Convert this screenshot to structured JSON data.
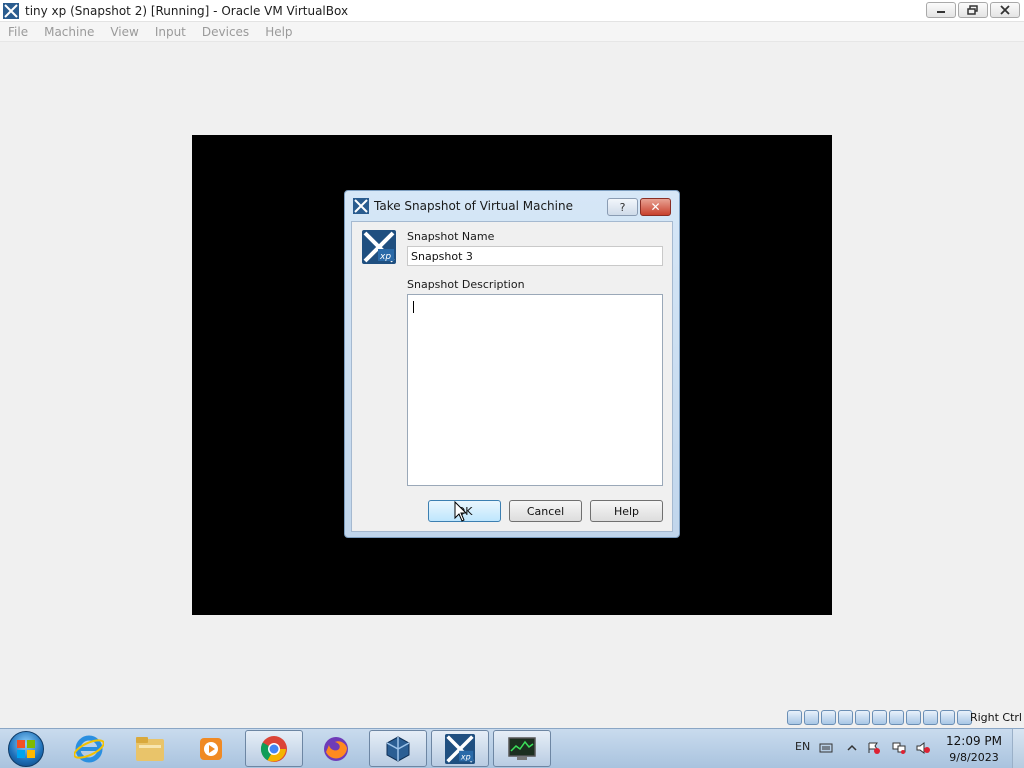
{
  "window": {
    "title": "tiny xp (Snapshot 2) [Running] - Oracle VM VirtualBox"
  },
  "menubar": {
    "items": [
      "File",
      "Machine",
      "View",
      "Input",
      "Devices",
      "Help"
    ]
  },
  "dialog": {
    "title": "Take Snapshot of Virtual Machine",
    "help_glyph": "?",
    "close_glyph": "✕",
    "name_label": "Snapshot Name",
    "name_value": "Snapshot 3",
    "description_label": "Snapshot Description",
    "description_value": "",
    "ok_label": "OK",
    "cancel_label": "Cancel",
    "help_label": "Help"
  },
  "statusbar": {
    "host_key": "Right Ctrl"
  },
  "taskbar": {
    "apps": [
      "start-button",
      "internet-explorer",
      "file-explorer",
      "media-player",
      "chrome",
      "firefox",
      "virtualbox-manager",
      "tiny-xp-vm",
      "task-manager"
    ]
  },
  "tray": {
    "language": "EN",
    "time": "12:09 PM",
    "date": "9/8/2023"
  },
  "colors": {
    "accent": "#3c7fb1",
    "dialog_frame": "#c1d6ec"
  }
}
